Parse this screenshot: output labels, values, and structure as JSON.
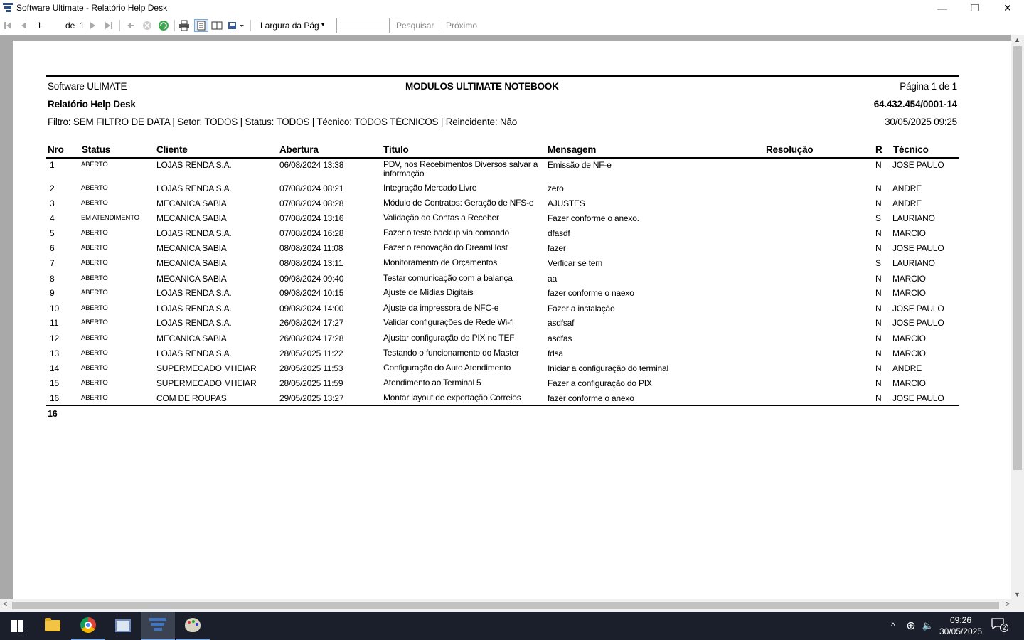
{
  "window": {
    "title": "Software Ultimate - Relatório Help Desk",
    "minimize_glyph": "—",
    "restore_glyph": "❐",
    "close_glyph": "✕"
  },
  "toolbar": {
    "page_current": "1",
    "page_of_label": "de",
    "page_total": "1",
    "zoom_value": "Largura da Pág",
    "search_label": "Pesquisar",
    "next_label": "Próximo",
    "icons": [
      "first-page-icon",
      "prev-page-icon",
      "next-page-icon",
      "last-page-icon",
      "back-icon",
      "stop-icon",
      "refresh-icon",
      "print-icon",
      "print-layout-icon",
      "page-setup-icon",
      "export-icon"
    ]
  },
  "report": {
    "company": "Software ULIMATE",
    "module": "MODULOS ULTIMATE NOTEBOOK",
    "page_info": "Página 1 de 1",
    "report_title": "Relatório Help Desk",
    "cnpj": "64.432.454/0001-14",
    "filter": "Filtro: SEM FILTRO DE DATA | Setor: TODOS | Status: TODOS | Técnico: TODOS TÉCNICOS | Reincidente: Não",
    "generated_at": "30/05/2025 09:25",
    "columns": {
      "nro": "Nro",
      "status": "Status",
      "cliente": "Cliente",
      "abertura": "Abertura",
      "titulo": "Título",
      "mensagem": "Mensagem",
      "resolucao": "Resolução",
      "r": "R",
      "tecnico": "Técnico"
    },
    "rows": [
      {
        "nro": "1",
        "status": "ABERTO",
        "cliente": "LOJAS RENDA S.A.",
        "abertura": "06/08/2024 13:38",
        "titulo": "PDV, nos Recebimentos Diversos salvar a informação",
        "mensagem": "Emissão de NF-e",
        "resolucao": "",
        "r": "N",
        "tecnico": "JOSE PAULO"
      },
      {
        "nro": "2",
        "status": "ABERTO",
        "cliente": "LOJAS RENDA S.A.",
        "abertura": "07/08/2024 08:21",
        "titulo": "Integração Mercado Livre",
        "mensagem": "zero",
        "resolucao": "",
        "r": "N",
        "tecnico": "ANDRE"
      },
      {
        "nro": "3",
        "status": "ABERTO",
        "cliente": "MECANICA SABIA",
        "abertura": "07/08/2024 08:28",
        "titulo": "Módulo de Contratos: Geração de NFS-e",
        "mensagem": "AJUSTES",
        "resolucao": "",
        "r": "N",
        "tecnico": "ANDRE"
      },
      {
        "nro": "4",
        "status": "EM ATENDIMENTO",
        "cliente": "MECANICA SABIA",
        "abertura": "07/08/2024 13:16",
        "titulo": "Validação do Contas a Receber",
        "mensagem": "Fazer conforme o anexo.",
        "resolucao": "",
        "r": "S",
        "tecnico": "LAURIANO"
      },
      {
        "nro": "5",
        "status": "ABERTO",
        "cliente": "LOJAS RENDA S.A.",
        "abertura": "07/08/2024 16:28",
        "titulo": "Fazer o teste backup via comando",
        "mensagem": "dfasdf",
        "resolucao": "",
        "r": "N",
        "tecnico": "MARCIO"
      },
      {
        "nro": "6",
        "status": "ABERTO",
        "cliente": "MECANICA SABIA",
        "abertura": "08/08/2024 11:08",
        "titulo": "Fazer o renovação do DreamHost",
        "mensagem": "fazer",
        "resolucao": "",
        "r": "N",
        "tecnico": "JOSE PAULO"
      },
      {
        "nro": "7",
        "status": "ABERTO",
        "cliente": "MECANICA SABIA",
        "abertura": "08/08/2024 13:11",
        "titulo": "Monitoramento de Orçamentos",
        "mensagem": "Verficar se tem",
        "resolucao": "",
        "r": "S",
        "tecnico": "LAURIANO"
      },
      {
        "nro": "8",
        "status": "ABERTO",
        "cliente": "MECANICA SABIA",
        "abertura": "09/08/2024 09:40",
        "titulo": "Testar comunicação com a balança",
        "mensagem": "aa",
        "resolucao": "",
        "r": "N",
        "tecnico": "MARCIO"
      },
      {
        "nro": "9",
        "status": "ABERTO",
        "cliente": "LOJAS RENDA S.A.",
        "abertura": "09/08/2024 10:15",
        "titulo": "Ajuste de Mídias Digitais",
        "mensagem": "fazer conforme o naexo",
        "resolucao": "",
        "r": "N",
        "tecnico": "MARCIO"
      },
      {
        "nro": "10",
        "status": "ABERTO",
        "cliente": "LOJAS RENDA S.A.",
        "abertura": "09/08/2024 14:00",
        "titulo": "Ajuste da impressora de NFC-e",
        "mensagem": "Fazer a instalação",
        "resolucao": "",
        "r": "N",
        "tecnico": "JOSE PAULO"
      },
      {
        "nro": "11",
        "status": "ABERTO",
        "cliente": "LOJAS RENDA S.A.",
        "abertura": "26/08/2024 17:27",
        "titulo": "Validar configurações de Rede Wi-fi",
        "mensagem": "asdfsaf",
        "resolucao": "",
        "r": "N",
        "tecnico": "JOSE PAULO"
      },
      {
        "nro": "12",
        "status": "ABERTO",
        "cliente": "MECANICA SABIA",
        "abertura": "26/08/2024 17:28",
        "titulo": "Ajustar configuração do PIX no TEF",
        "mensagem": "asdfas",
        "resolucao": "",
        "r": "N",
        "tecnico": "MARCIO"
      },
      {
        "nro": "13",
        "status": "ABERTO",
        "cliente": "LOJAS RENDA S.A.",
        "abertura": "28/05/2025 11:22",
        "titulo": "Testando o funcionamento do Master",
        "mensagem": "fdsa",
        "resolucao": "",
        "r": "N",
        "tecnico": "MARCIO"
      },
      {
        "nro": "14",
        "status": "ABERTO",
        "cliente": "SUPERMECADO MHEIAR",
        "abertura": "28/05/2025 11:53",
        "titulo": "Configuração do Auto Atendimento",
        "mensagem": "Iniciar a configuração do terminal",
        "resolucao": "",
        "r": "N",
        "tecnico": "ANDRE"
      },
      {
        "nro": "15",
        "status": "ABERTO",
        "cliente": "SUPERMECADO MHEIAR",
        "abertura": "28/05/2025 11:59",
        "titulo": "Atendimento ao Terminal 5",
        "mensagem": "Fazer a configuração do PIX",
        "resolucao": "",
        "r": "N",
        "tecnico": "MARCIO"
      },
      {
        "nro": "16",
        "status": "ABERTO",
        "cliente": "COM DE ROUPAS",
        "abertura": "29/05/2025 13:27",
        "titulo": "Montar layout de exportação Correios",
        "mensagem": "fazer conforme o anexo",
        "resolucao": "",
        "r": "N",
        "tecnico": "JOSE PAULO"
      }
    ],
    "total": "16"
  },
  "taskbar": {
    "apps": [
      "windows-start-icon",
      "file-explorer-icon",
      "chrome-icon",
      "remote-desktop-icon",
      "software-ultimate-icon",
      "paint-icon"
    ],
    "tray_chevron": "^",
    "network_glyph": "⊕",
    "volume_glyph": "🔈",
    "time": "09:26",
    "date": "30/05/2025",
    "notification_count": "2"
  },
  "scrollbar": {
    "up_glyph": "▲",
    "down_glyph": "▼",
    "left_glyph": "<",
    "right_glyph": ">"
  }
}
